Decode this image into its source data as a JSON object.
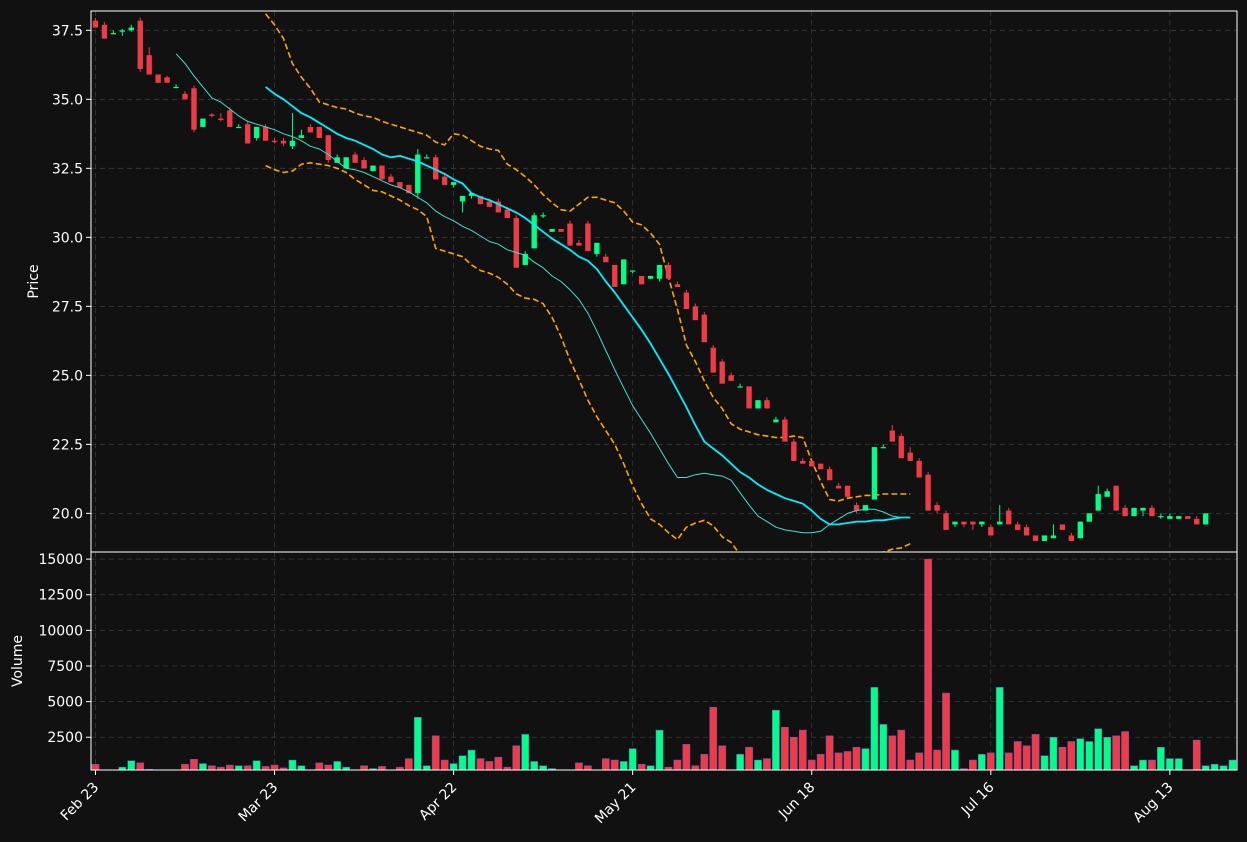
{
  "colors": {
    "background": "#111111",
    "axes_edge": "#ffffff",
    "grid": "#3a3a3a",
    "up": "#00ff88",
    "down": "#ef3b46",
    "ma_fast": "#00f0ff",
    "ma_slow": "#40e0d0",
    "bollinger": "#ffa500"
  },
  "chart_data": [
    {
      "type": "candlestick",
      "panel": "price",
      "ylabel": "Price",
      "ylim": [
        18.6,
        38.2
      ],
      "yticks": [
        20.0,
        22.5,
        25.0,
        27.5,
        30.0,
        32.5,
        35.0,
        37.5
      ],
      "ytick_labels": [
        "20.0",
        "22.5",
        "25.0",
        "27.5",
        "30.0",
        "32.5",
        "35.0",
        "37.5"
      ],
      "grid": true,
      "x_index_range": [
        -0.5,
        127.5
      ],
      "candles": [
        [
          37.85,
          37.95,
          37.6,
          37.6
        ],
        [
          37.7,
          37.8,
          37.2,
          37.2
        ],
        [
          37.4,
          37.5,
          37.35,
          37.4
        ],
        [
          37.45,
          37.55,
          37.3,
          37.5
        ],
        [
          37.5,
          37.7,
          37.45,
          37.6
        ],
        [
          37.85,
          37.95,
          36.0,
          36.1
        ],
        [
          36.6,
          36.9,
          35.9,
          35.9
        ],
        [
          35.9,
          35.9,
          35.6,
          35.6
        ],
        [
          35.8,
          35.85,
          35.6,
          35.6
        ],
        [
          35.45,
          35.55,
          35.4,
          35.45
        ],
        [
          35.2,
          35.3,
          35.0,
          35.0
        ],
        [
          35.4,
          35.5,
          33.8,
          33.9
        ],
        [
          34.0,
          34.3,
          34.0,
          34.3
        ],
        [
          34.45,
          34.5,
          34.35,
          34.4
        ],
        [
          34.3,
          34.5,
          34.2,
          34.25
        ],
        [
          34.6,
          34.7,
          34.0,
          34.0
        ],
        [
          34.0,
          34.1,
          34.0,
          34.0
        ],
        [
          34.1,
          34.2,
          33.4,
          33.4
        ],
        [
          33.6,
          34.0,
          33.5,
          34.0
        ],
        [
          34.0,
          34.1,
          33.5,
          33.5
        ],
        [
          33.5,
          33.6,
          33.4,
          33.45
        ],
        [
          33.5,
          33.6,
          33.3,
          33.4
        ],
        [
          33.3,
          34.5,
          33.2,
          33.5
        ],
        [
          33.6,
          33.9,
          33.6,
          33.7
        ],
        [
          34.0,
          34.1,
          33.8,
          33.8
        ],
        [
          34.0,
          34.0,
          33.6,
          33.6
        ],
        [
          33.7,
          33.7,
          32.7,
          32.8
        ],
        [
          32.7,
          33.0,
          32.7,
          32.9
        ],
        [
          32.5,
          32.9,
          32.5,
          32.9
        ],
        [
          33.0,
          33.1,
          32.7,
          32.7
        ],
        [
          32.8,
          32.9,
          32.5,
          32.5
        ],
        [
          32.4,
          32.6,
          32.4,
          32.6
        ],
        [
          32.6,
          32.6,
          32.1,
          32.1
        ],
        [
          32.2,
          32.3,
          32.0,
          32.0
        ],
        [
          32.0,
          32.0,
          31.8,
          31.8
        ],
        [
          31.9,
          31.9,
          31.6,
          31.6
        ],
        [
          31.6,
          33.2,
          31.4,
          33.0
        ],
        [
          32.9,
          33.0,
          32.9,
          32.9
        ],
        [
          32.9,
          33.0,
          32.1,
          32.1
        ],
        [
          32.2,
          32.3,
          31.9,
          31.9
        ],
        [
          31.9,
          32.0,
          31.8,
          32.0
        ],
        [
          31.3,
          31.5,
          30.9,
          31.5
        ],
        [
          31.5,
          31.6,
          31.4,
          31.6
        ],
        [
          31.5,
          31.5,
          31.2,
          31.2
        ],
        [
          31.3,
          31.4,
          31.1,
          31.1
        ],
        [
          31.3,
          31.4,
          30.9,
          30.9
        ],
        [
          31.0,
          31.1,
          30.7,
          30.7
        ],
        [
          30.7,
          30.8,
          28.9,
          28.9
        ],
        [
          29.0,
          29.5,
          29.0,
          29.4
        ],
        [
          29.6,
          30.9,
          29.6,
          30.8
        ],
        [
          30.8,
          30.9,
          30.7,
          30.8
        ],
        [
          30.2,
          30.3,
          30.2,
          30.3
        ],
        [
          30.3,
          30.3,
          30.2,
          30.2
        ],
        [
          30.5,
          30.6,
          29.7,
          29.7
        ],
        [
          29.8,
          29.9,
          29.7,
          29.7
        ],
        [
          30.5,
          30.6,
          29.5,
          29.5
        ],
        [
          29.4,
          29.8,
          29.3,
          29.8
        ],
        [
          29.3,
          29.4,
          29.1,
          29.1
        ],
        [
          29.0,
          29.0,
          28.2,
          28.2
        ],
        [
          28.3,
          29.2,
          28.3,
          29.2
        ],
        [
          28.8,
          28.8,
          28.7,
          28.8
        ],
        [
          28.6,
          28.6,
          28.3,
          28.3
        ],
        [
          28.5,
          28.6,
          28.5,
          28.6
        ],
        [
          28.5,
          28.8,
          28.4,
          29.0
        ],
        [
          29.0,
          29.1,
          28.5,
          28.5
        ],
        [
          28.3,
          28.4,
          28.2,
          28.2
        ],
        [
          28.0,
          28.1,
          27.4,
          27.4
        ],
        [
          27.5,
          27.6,
          27.0,
          27.0
        ],
        [
          27.2,
          27.3,
          26.2,
          26.2
        ],
        [
          26.0,
          26.1,
          25.1,
          25.1
        ],
        [
          25.5,
          25.6,
          24.7,
          24.7
        ],
        [
          25.0,
          25.1,
          24.8,
          24.8
        ],
        [
          24.6,
          24.7,
          24.6,
          24.6
        ],
        [
          24.6,
          24.6,
          23.8,
          23.8
        ],
        [
          23.8,
          24.1,
          23.8,
          24.1
        ],
        [
          24.1,
          24.2,
          23.8,
          23.8
        ],
        [
          23.3,
          23.5,
          23.3,
          23.4
        ],
        [
          23.4,
          23.5,
          22.6,
          22.6
        ],
        [
          22.6,
          22.7,
          21.9,
          21.9
        ],
        [
          21.9,
          22.0,
          21.8,
          21.8
        ],
        [
          21.9,
          21.9,
          21.7,
          21.7
        ],
        [
          21.8,
          21.8,
          21.6,
          21.6
        ],
        [
          21.6,
          21.7,
          21.2,
          21.2
        ],
        [
          21.0,
          21.1,
          20.9,
          20.9
        ],
        [
          21.0,
          21.0,
          20.6,
          20.6
        ],
        [
          20.3,
          20.4,
          20.0,
          20.1
        ],
        [
          20.1,
          20.3,
          20.1,
          20.3
        ],
        [
          20.5,
          22.4,
          20.5,
          22.4
        ],
        [
          22.4,
          22.5,
          22.4,
          22.4
        ],
        [
          23.0,
          23.2,
          22.6,
          22.6
        ],
        [
          22.8,
          22.9,
          22.0,
          22.0
        ],
        [
          22.2,
          22.4,
          21.9,
          21.9
        ],
        [
          21.9,
          22.0,
          21.3,
          21.3
        ],
        [
          21.4,
          21.5,
          20.1,
          20.1
        ],
        [
          20.3,
          20.4,
          20.0,
          20.1
        ],
        [
          20.0,
          20.1,
          19.4,
          19.4
        ],
        [
          19.6,
          19.7,
          19.5,
          19.7
        ],
        [
          19.7,
          19.7,
          19.5,
          19.6
        ],
        [
          19.7,
          19.7,
          19.4,
          19.6
        ],
        [
          19.6,
          19.7,
          19.5,
          19.7
        ],
        [
          19.5,
          19.6,
          19.2,
          19.2
        ],
        [
          19.6,
          20.3,
          19.6,
          19.7
        ],
        [
          20.1,
          20.2,
          19.6,
          19.6
        ],
        [
          19.6,
          19.7,
          19.4,
          19.4
        ],
        [
          19.5,
          19.6,
          19.2,
          19.2
        ],
        [
          19.2,
          19.2,
          19.0,
          19.0
        ],
        [
          19.0,
          19.2,
          19.0,
          19.2
        ],
        [
          19.1,
          19.6,
          19.1,
          19.2
        ],
        [
          19.6,
          19.6,
          19.4,
          19.4
        ],
        [
          19.2,
          19.3,
          19.0,
          19.0
        ],
        [
          19.1,
          19.7,
          19.1,
          19.7
        ],
        [
          19.7,
          20.0,
          19.7,
          20.0
        ],
        [
          20.1,
          21.0,
          20.1,
          20.7
        ],
        [
          20.6,
          20.9,
          20.6,
          20.8
        ],
        [
          21.0,
          21.0,
          20.1,
          20.1
        ],
        [
          20.2,
          20.3,
          19.9,
          19.9
        ],
        [
          19.9,
          20.2,
          19.9,
          20.2
        ],
        [
          20.1,
          20.2,
          19.9,
          20.2
        ],
        [
          20.2,
          20.3,
          19.9,
          19.9
        ],
        [
          19.9,
          20.0,
          19.8,
          19.9
        ],
        [
          19.8,
          20.0,
          19.8,
          19.9
        ],
        [
          19.8,
          19.9,
          19.8,
          19.9
        ],
        [
          19.9,
          19.9,
          19.8,
          19.8
        ],
        [
          19.8,
          19.9,
          19.6,
          19.6
        ],
        [
          19.6,
          20.0,
          19.6,
          20.0
        ]
      ],
      "ma_fast": {
        "start_index": 19,
        "values": [
          35.45,
          35.2,
          35.0,
          34.75,
          34.5,
          34.35,
          34.15,
          33.95,
          33.75,
          33.6,
          33.5,
          33.35,
          33.2,
          33.0,
          32.9,
          32.95,
          32.85,
          32.75,
          32.6,
          32.45,
          32.3,
          32.1,
          31.95,
          31.6,
          31.45,
          31.35,
          31.2,
          31.05,
          30.9,
          30.7,
          30.45,
          30.2,
          29.95,
          29.75,
          29.55,
          29.3,
          29.15,
          28.85,
          28.4,
          28.0,
          27.55,
          27.1,
          26.65,
          26.15,
          25.6,
          25.05,
          24.45,
          23.85,
          23.2,
          22.6,
          22.35,
          22.1,
          21.8,
          21.5,
          21.3,
          21.05,
          20.85,
          20.7,
          20.55,
          20.45,
          20.35,
          20.1,
          19.8,
          19.6,
          19.6,
          19.65,
          19.7,
          19.7,
          19.75,
          19.75,
          19.8,
          19.85,
          19.85
        ]
      },
      "ma_slow": {
        "start_index": 9,
        "values": [
          36.65,
          36.3,
          35.85,
          35.45,
          35.05,
          34.9,
          34.65,
          34.4,
          34.2,
          34.1,
          34.0,
          33.9,
          33.75,
          33.65,
          33.5,
          33.3,
          33.2,
          33.0,
          32.75,
          32.5,
          32.45,
          32.35,
          32.2,
          32.05,
          31.9,
          31.8,
          31.65,
          31.45,
          31.25,
          30.95,
          30.75,
          30.6,
          30.4,
          30.25,
          30.05,
          29.85,
          29.75,
          29.55,
          29.45,
          29.35,
          29.1,
          28.9,
          28.6,
          28.4,
          28.1,
          27.75,
          27.25,
          26.6,
          25.9,
          25.2,
          24.55,
          23.9,
          23.4,
          22.9,
          22.35,
          21.8,
          21.3,
          21.3,
          21.4,
          21.45,
          21.4,
          21.35,
          21.2,
          20.75,
          20.3,
          19.9,
          19.7,
          19.5,
          19.4,
          19.35,
          19.3,
          19.3,
          19.35,
          19.6,
          19.8,
          20.0,
          20.1,
          20.15,
          20.15,
          20.05,
          19.9,
          19.85,
          19.85
        ]
      },
      "bollinger_upper": {
        "start_index": 19,
        "values": [
          38.1,
          37.7,
          37.2,
          36.3,
          35.8,
          35.4,
          34.9,
          34.8,
          34.7,
          34.65,
          34.5,
          34.4,
          34.35,
          34.2,
          34.1,
          34.0,
          33.9,
          33.8,
          33.7,
          33.45,
          33.35,
          33.75,
          33.7,
          33.5,
          33.3,
          33.2,
          33.15,
          32.65,
          32.45,
          32.2,
          31.9,
          31.55,
          31.25,
          31.0,
          30.95,
          31.2,
          31.45,
          31.45,
          31.35,
          31.25,
          30.95,
          30.55,
          30.45,
          30.15,
          29.75,
          28.55,
          27.4,
          26.1,
          25.5,
          24.8,
          24.2,
          23.8,
          23.25,
          23.05,
          22.95,
          22.85,
          22.8,
          22.75,
          22.75,
          22.8,
          22.75,
          21.9,
          21.15,
          20.5,
          20.45,
          20.55,
          20.6,
          20.65,
          20.65,
          20.7,
          20.7,
          20.7,
          20.7
        ]
      },
      "bollinger_lower": {
        "start_index": 19,
        "values": [
          32.6,
          32.45,
          32.35,
          32.4,
          32.65,
          32.7,
          32.65,
          32.6,
          32.5,
          32.35,
          32.1,
          31.9,
          31.7,
          31.65,
          31.5,
          31.35,
          31.15,
          31.0,
          30.75,
          29.6,
          29.5,
          29.4,
          29.3,
          29.0,
          28.8,
          28.7,
          28.55,
          28.3,
          27.95,
          27.8,
          27.75,
          27.6,
          27.1,
          26.4,
          25.55,
          24.85,
          24.1,
          23.5,
          23.0,
          22.5,
          21.8,
          21.0,
          20.35,
          19.8,
          19.6,
          19.3,
          19.05,
          19.5,
          19.65,
          19.75,
          19.55,
          19.15,
          18.95,
          18.5,
          18.2,
          18.0,
          17.9,
          17.85,
          17.9,
          18.0,
          18.3,
          18.45,
          18.55,
          18.6,
          18.5,
          18.4,
          18.4,
          18.45,
          18.55,
          18.6,
          18.7,
          18.75,
          18.9
        ]
      }
    },
    {
      "type": "bar",
      "panel": "volume",
      "ylabel": "Volume",
      "ylim": [
        200,
        15500
      ],
      "yticks": [
        2500,
        5000,
        7500,
        10000,
        12500,
        15000
      ],
      "ytick_labels": [
        "2500",
        "5000",
        "7500",
        "10000",
        "12500",
        "15000"
      ],
      "grid": true,
      "x_index_range": [
        -0.5,
        127.5
      ],
      "xticks": [
        0,
        20,
        40,
        60,
        80,
        100,
        120
      ],
      "xtick_labels": [
        "Feb 23",
        "Mar 23",
        "Apr 22",
        "May 21",
        "Jun 18",
        "Jul 16",
        "Aug 13"
      ],
      "values": [
        600,
        150,
        200,
        400,
        850,
        700,
        250,
        150,
        100,
        100,
        600,
        950,
        650,
        500,
        400,
        550,
        500,
        500,
        850,
        450,
        550,
        350,
        900,
        500,
        100,
        700,
        550,
        800,
        400,
        100,
        500,
        300,
        450,
        100,
        400,
        1000,
        3900,
        500,
        2600,
        900,
        650,
        1200,
        1600,
        1000,
        800,
        1100,
        400,
        1900,
        2700,
        800,
        500,
        300,
        200,
        200,
        700,
        500,
        200,
        1000,
        900,
        800,
        1700,
        600,
        500,
        3000,
        400,
        900,
        2000,
        500,
        1300,
        4600,
        1900,
        150,
        1300,
        1800,
        900,
        1000,
        4400,
        3200,
        2500,
        3000,
        900,
        1300,
        2600,
        1400,
        1500,
        1800,
        1700,
        6000,
        3400,
        2600,
        3000,
        900,
        1400,
        15000,
        1600,
        5600,
        1600,
        300,
        900,
        1300,
        1400,
        6000,
        1400,
        2200,
        1900,
        2700,
        1200,
        2500,
        1800,
        2200,
        2400,
        2200,
        3100,
        2500,
        2600,
        2900,
        500,
        900,
        900,
        1800,
        1000,
        1000,
        150,
        2300,
        500,
        600,
        500,
        900
      ]
    }
  ]
}
